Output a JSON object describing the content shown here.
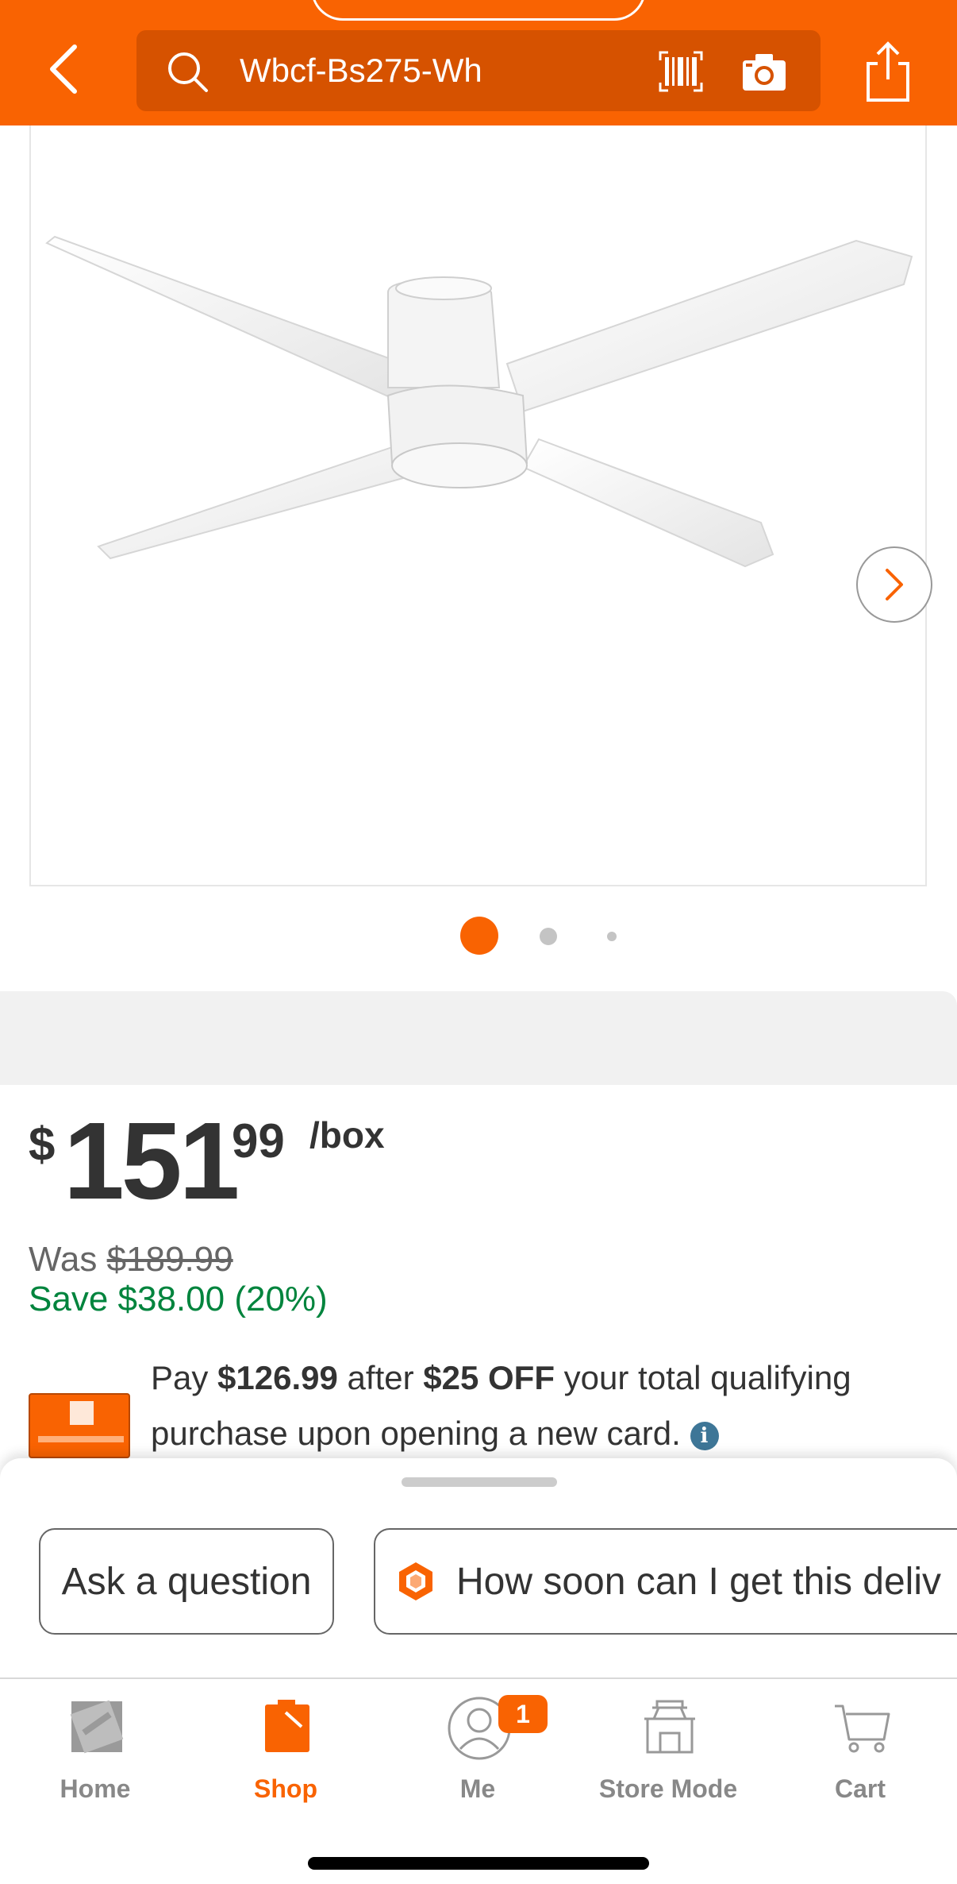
{
  "header": {
    "search_value": "Wbcf-Bs275-Wh",
    "icons": [
      "back-chevron-icon",
      "search-icon",
      "barcode-icon",
      "camera-icon",
      "share-icon"
    ],
    "background_color": "#f96302"
  },
  "gallery": {
    "image_icon": "ceiling-fan-image",
    "next_icon": "chevron-right-icon",
    "dot_count": 3,
    "active_dot": 1
  },
  "pricing": {
    "currency": "$",
    "whole": "151",
    "cents": "99",
    "unit": "/box",
    "was_label": "Was",
    "was_amount": "$189.99",
    "save_text": "Save $38.00 (20%)"
  },
  "promo": {
    "text_1": "Pay ",
    "amount_after": "$126.99",
    "text_2": " after ",
    "discount": "$25 OFF",
    "text_3": " your total qualifying purchase upon opening a new card. "
  },
  "sheet": {
    "chips": [
      {
        "label": "Ask a question"
      },
      {
        "label": "How soon can I get this deliv"
      }
    ]
  },
  "tabbar": {
    "items": [
      {
        "label": "Home",
        "active": false
      },
      {
        "label": "Shop",
        "active": true
      },
      {
        "label": "Me",
        "active": false,
        "badge": "1"
      },
      {
        "label": "Store Mode",
        "active": false
      },
      {
        "label": "Cart",
        "active": false
      }
    ]
  },
  "colors": {
    "brand_orange": "#f96302",
    "save_green": "#00843d",
    "info_blue": "#3e7697"
  }
}
